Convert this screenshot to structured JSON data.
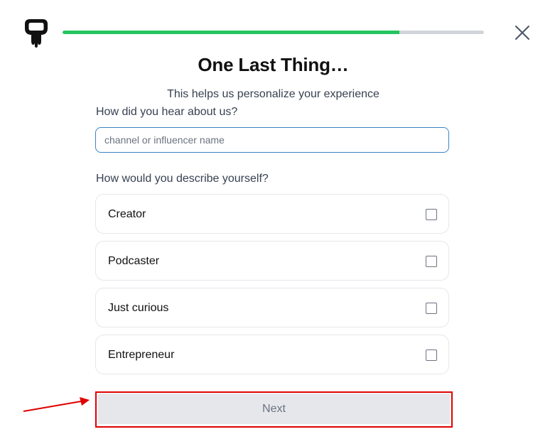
{
  "header": {
    "progress_percent": 80,
    "progress_color": "#22c55e",
    "logo_icon": "ghost-logo-icon",
    "close_icon": "close-icon"
  },
  "main": {
    "title": "One Last Thing…",
    "subtitle": "This helps us personalize your experience"
  },
  "referral": {
    "label": "How did you hear about us?",
    "value": "",
    "placeholder": "channel or influencer name"
  },
  "describe": {
    "label": "How would you describe yourself?",
    "options": [
      {
        "label": "Creator",
        "checked": false
      },
      {
        "label": "Podcaster",
        "checked": false
      },
      {
        "label": "Just curious",
        "checked": false
      },
      {
        "label": "Entrepreneur",
        "checked": false
      }
    ]
  },
  "footer": {
    "next_label": "Next",
    "annotation_color": "#e00000",
    "annotation_icon": "red-arrow-icon"
  }
}
